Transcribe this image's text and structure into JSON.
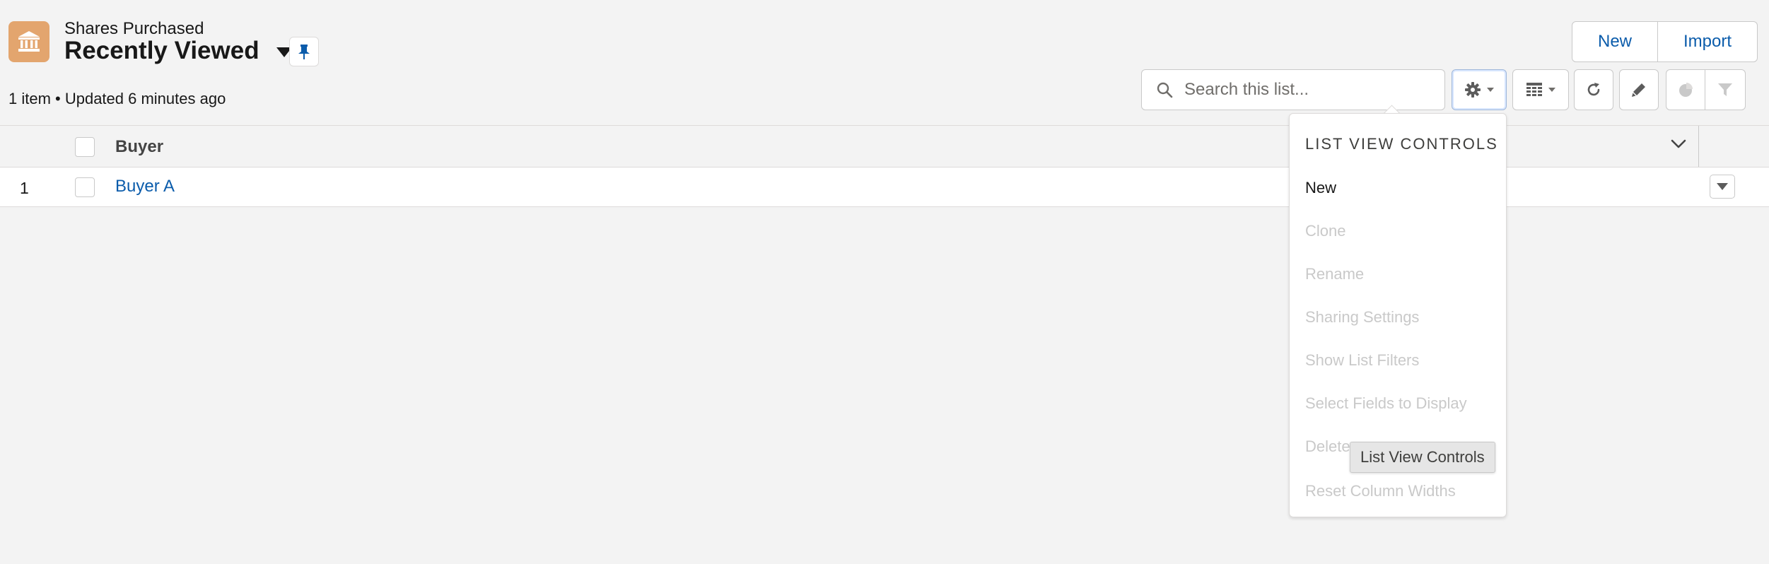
{
  "header": {
    "object_name": "Shares Purchased",
    "view_title": "Recently Viewed",
    "meta": "1 item • Updated 6 minutes ago",
    "icon": "bank-icon",
    "accent_color": "#e3a56e"
  },
  "actions": {
    "new_label": "New",
    "import_label": "Import"
  },
  "search": {
    "placeholder": "Search this list..."
  },
  "toolbar": {
    "icons": [
      "gear-icon",
      "table-icon",
      "refresh-icon",
      "pencil-icon",
      "chart-icon",
      "filter-icon"
    ]
  },
  "table": {
    "columns": [
      "Buyer"
    ],
    "rows": [
      {
        "num": "1",
        "buyer": "Buyer A"
      }
    ]
  },
  "menu": {
    "heading": "LIST VIEW CONTROLS",
    "items": [
      {
        "label": "New",
        "enabled": true
      },
      {
        "label": "Clone",
        "enabled": false
      },
      {
        "label": "Rename",
        "enabled": false
      },
      {
        "label": "Sharing Settings",
        "enabled": false
      },
      {
        "label": "Show List Filters",
        "enabled": false
      },
      {
        "label": "Select Fields to Display",
        "enabled": false
      },
      {
        "label": "Delete",
        "enabled": false
      },
      {
        "label": "Reset Column Widths",
        "enabled": false
      }
    ]
  },
  "tooltip": {
    "text": "List View Controls"
  },
  "colors": {
    "link": "#0b5cab",
    "disabled": "#c9c9c9",
    "background": "#f3f3f3"
  }
}
